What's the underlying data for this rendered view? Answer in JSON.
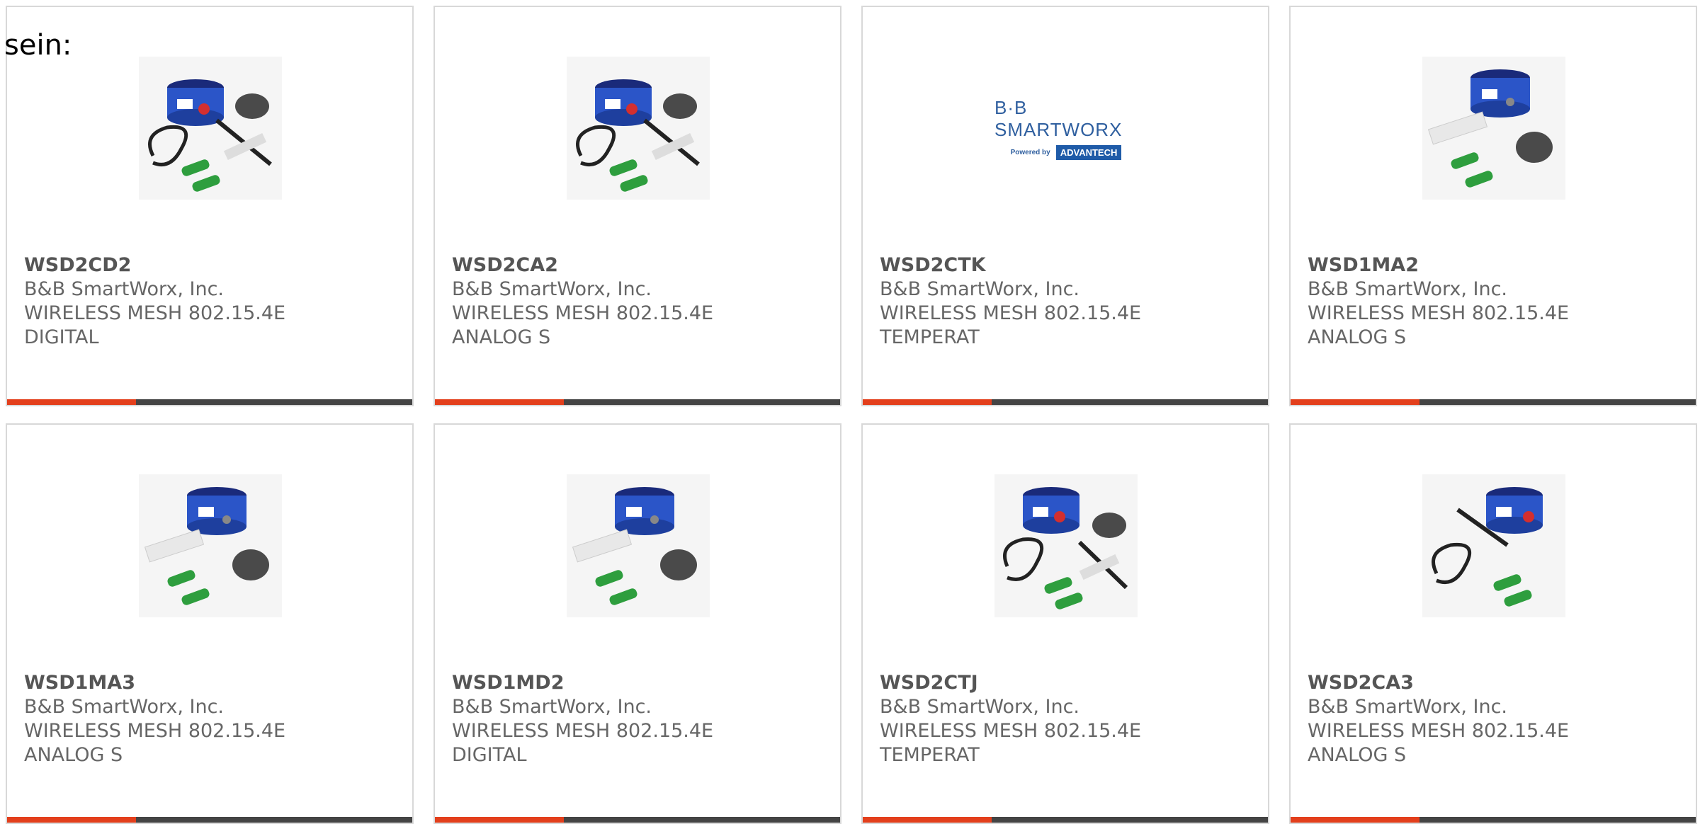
{
  "intro_text": "sein:",
  "colors": {
    "accent": "#e33f1c",
    "bar": "#444444",
    "border": "#d8d8d8",
    "text": "#666666"
  },
  "products": [
    {
      "part": "WSD2CD2",
      "maker": "B&B SmartWorx, Inc.",
      "desc1": "WIRELESS MESH 802.15.4E",
      "desc2": "DIGITAL",
      "image": "sensor-kit-antenna-icon"
    },
    {
      "part": "WSD2CA2",
      "maker": "B&B SmartWorx, Inc.",
      "desc1": "WIRELESS MESH 802.15.4E",
      "desc2": "ANALOG S",
      "image": "sensor-kit-antenna-icon"
    },
    {
      "part": "WSD2CTK",
      "maker": "B&B SmartWorx, Inc.",
      "desc1": "WIRELESS MESH 802.15.4E",
      "desc2": "TEMPERAT",
      "image": "bb-smartworx-logo",
      "logo": {
        "brand": "B·B SMARTWORX",
        "powered": "Powered by",
        "advantech": "ADVANTECH"
      }
    },
    {
      "part": "WSD1MA2",
      "maker": "B&B SmartWorx, Inc.",
      "desc1": "WIRELESS MESH 802.15.4E",
      "desc2": "ANALOG S",
      "image": "sensor-kit-icon"
    },
    {
      "part": "WSD1MA3",
      "maker": "B&B SmartWorx, Inc.",
      "desc1": "WIRELESS MESH 802.15.4E",
      "desc2": "ANALOG S",
      "image": "sensor-kit-icon"
    },
    {
      "part": "WSD1MD2",
      "maker": "B&B SmartWorx, Inc.",
      "desc1": "WIRELESS MESH 802.15.4E",
      "desc2": "DIGITAL",
      "image": "sensor-kit-icon"
    },
    {
      "part": "WSD2CTJ",
      "maker": "B&B SmartWorx, Inc.",
      "desc1": "WIRELESS MESH 802.15.4E",
      "desc2": "TEMPERAT",
      "image": "sensor-kit-antenna-icon"
    },
    {
      "part": "WSD2CA3",
      "maker": "B&B SmartWorx, Inc.",
      "desc1": "WIRELESS MESH 802.15.4E",
      "desc2": "ANALOG S",
      "image": "sensor-kit-antenna-icon"
    }
  ]
}
